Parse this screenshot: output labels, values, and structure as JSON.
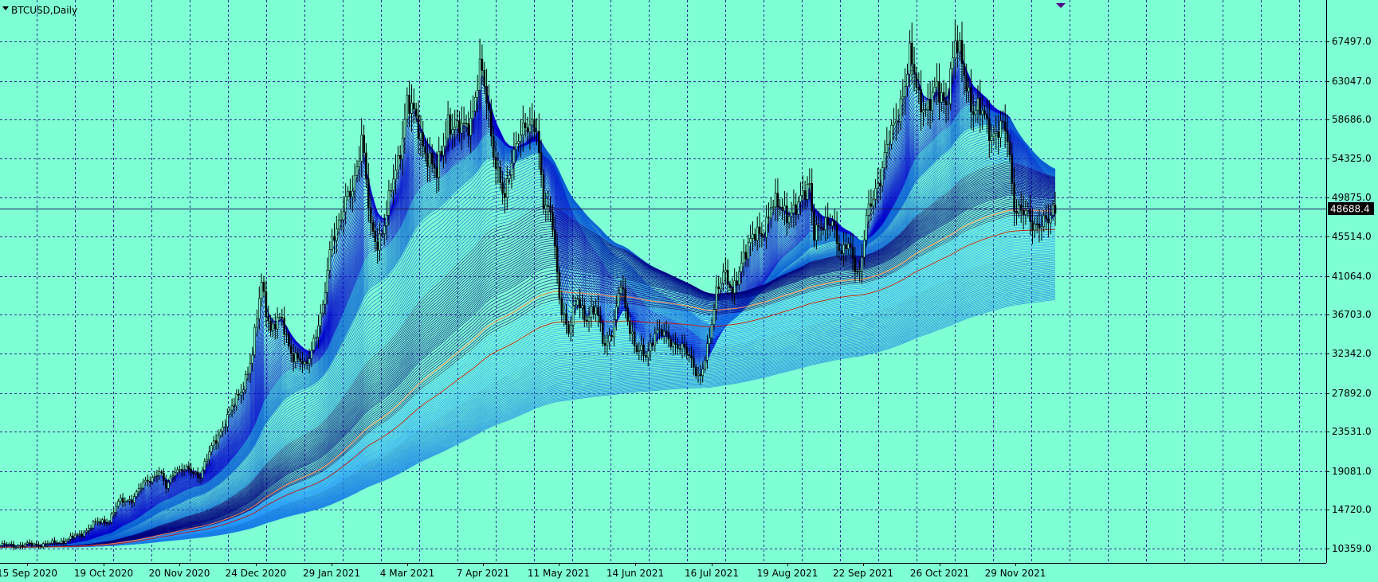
{
  "chart_data": {
    "type": "candlestick",
    "symbol_label": "BTCUSD,Daily",
    "current_price": "48688.4",
    "y_ticks": [
      "67497.0",
      "63047.0",
      "58686.0",
      "54325.0",
      "49875.0",
      "45514.0",
      "41064.0",
      "36703.0",
      "32342.0",
      "27892.0",
      "23531.0",
      "19081.0",
      "14720.0",
      "10359.0"
    ],
    "x_ticks": [
      "15 Sep 2020",
      "19 Oct 2020",
      "20 Nov 2020",
      "24 Dec 2020",
      "29 Jan 2021",
      "4 Mar 2021",
      "7 Apr 2021",
      "11 May 2021",
      "14 Jun 2021",
      "16 Jul 2021",
      "19 Aug 2021",
      "22 Sep 2021",
      "26 Oct 2021",
      "29 Nov 2021"
    ],
    "ylim": [
      8400,
      69500
    ],
    "price_series": [
      [
        "2020-09-15",
        10700
      ],
      [
        "2020-09-25",
        10750
      ],
      [
        "2020-10-08",
        10900
      ],
      [
        "2020-10-15",
        11400
      ],
      [
        "2020-10-20",
        11900
      ],
      [
        "2020-10-26",
        13100
      ],
      [
        "2020-11-02",
        13600
      ],
      [
        "2020-11-06",
        15500
      ],
      [
        "2020-11-12",
        16000
      ],
      [
        "2020-11-18",
        17800
      ],
      [
        "2020-11-24",
        19100
      ],
      [
        "2020-11-27",
        17100
      ],
      [
        "2020-12-01",
        19400
      ],
      [
        "2020-12-08",
        19000
      ],
      [
        "2020-12-12",
        18700
      ],
      [
        "2020-12-16",
        21000
      ],
      [
        "2020-12-21",
        23800
      ],
      [
        "2020-12-27",
        26500
      ],
      [
        "2020-12-31",
        29000
      ],
      [
        "2021-01-04",
        32000
      ],
      [
        "2021-01-08",
        40500
      ],
      [
        "2021-01-12",
        35000
      ],
      [
        "2021-01-17",
        36000
      ],
      [
        "2021-01-22",
        32000
      ],
      [
        "2021-01-27",
        30700
      ],
      [
        "2021-01-31",
        34000
      ],
      [
        "2021-02-04",
        37000
      ],
      [
        "2021-02-08",
        46000
      ],
      [
        "2021-02-12",
        47500
      ],
      [
        "2021-02-17",
        51000
      ],
      [
        "2021-02-21",
        57000
      ],
      [
        "2021-02-25",
        46000
      ],
      [
        "2021-02-28",
        45000
      ],
      [
        "2021-03-04",
        48000
      ],
      [
        "2021-03-09",
        54000
      ],
      [
        "2021-03-13",
        61000
      ],
      [
        "2021-03-17",
        58000
      ],
      [
        "2021-03-22",
        55000
      ],
      [
        "2021-03-26",
        52000
      ],
      [
        "2021-03-31",
        59000
      ],
      [
        "2021-04-04",
        57000
      ],
      [
        "2021-04-08",
        58000
      ],
      [
        "2021-04-11",
        60000
      ],
      [
        "2021-04-14",
        64000
      ],
      [
        "2021-04-17",
        61000
      ],
      [
        "2021-04-21",
        54000
      ],
      [
        "2021-04-25",
        49000
      ],
      [
        "2021-04-28",
        54500
      ],
      [
        "2021-05-01",
        57500
      ],
      [
        "2021-05-05",
        57000
      ],
      [
        "2021-05-09",
        58500
      ],
      [
        "2021-05-12",
        49500
      ],
      [
        "2021-05-16",
        46500
      ],
      [
        "2021-05-19",
        39000
      ],
      [
        "2021-05-23",
        34500
      ],
      [
        "2021-05-27",
        38500
      ],
      [
        "2021-05-31",
        36500
      ],
      [
        "2021-06-04",
        37000
      ],
      [
        "2021-06-08",
        33500
      ],
      [
        "2021-06-12",
        35500
      ],
      [
        "2021-06-15",
        40000
      ],
      [
        "2021-06-19",
        35500
      ],
      [
        "2021-06-22",
        32500
      ],
      [
        "2021-06-26",
        32000
      ],
      [
        "2021-06-30",
        35000
      ],
      [
        "2021-07-05",
        34000
      ],
      [
        "2021-07-10",
        33500
      ],
      [
        "2021-07-15",
        31800
      ],
      [
        "2021-07-20",
        29900
      ],
      [
        "2021-07-24",
        33500
      ],
      [
        "2021-07-27",
        39500
      ],
      [
        "2021-07-30",
        42000
      ],
      [
        "2021-08-03",
        38500
      ],
      [
        "2021-08-08",
        44000
      ],
      [
        "2021-08-12",
        45000
      ],
      [
        "2021-08-16",
        46000
      ],
      [
        "2021-08-20",
        49000
      ],
      [
        "2021-08-24",
        48500
      ],
      [
        "2021-08-28",
        48500
      ],
      [
        "2021-09-01",
        48500
      ],
      [
        "2021-09-06",
        52000
      ],
      [
        "2021-09-08",
        46200
      ],
      [
        "2021-09-12",
        46000
      ],
      [
        "2021-09-16",
        48000
      ],
      [
        "2021-09-20",
        43000
      ],
      [
        "2021-09-23",
        44500
      ],
      [
        "2021-09-28",
        41500
      ],
      [
        "2021-10-01",
        47000
      ],
      [
        "2021-10-05",
        51000
      ],
      [
        "2021-10-09",
        54500
      ],
      [
        "2021-10-13",
        57500
      ],
      [
        "2021-10-16",
        61000
      ],
      [
        "2021-10-20",
        65500
      ],
      [
        "2021-10-24",
        61000
      ],
      [
        "2021-10-28",
        60500
      ],
      [
        "2021-11-01",
        61500
      ],
      [
        "2021-11-05",
        61000
      ],
      [
        "2021-11-09",
        67000
      ],
      [
        "2021-11-13",
        64000
      ],
      [
        "2021-11-17",
        60000
      ],
      [
        "2021-11-21",
        59000
      ],
      [
        "2021-11-25",
        57500
      ],
      [
        "2021-11-29",
        57500
      ],
      [
        "2021-12-02",
        56500
      ],
      [
        "2021-12-05",
        49500
      ],
      [
        "2021-12-09",
        48000
      ],
      [
        "2021-12-13",
        46800
      ],
      [
        "2021-12-16",
        47500
      ],
      [
        "2021-12-20",
        46800
      ],
      [
        "2021-12-23",
        48600
      ]
    ],
    "series": [
      {
        "values": []
      },
      {
        "values": []
      }
    ],
    "colors": {
      "background": "#7fffd4",
      "grid": "#2a2a8c",
      "candle": "#000000",
      "ma_dark": "#000080",
      "ma_mid": "#0000cd",
      "ma_light": "#1e90ff",
      "ma_orange": "#ff7f50",
      "ma_red": "#b22222",
      "price_line": "#1a1a66",
      "tag_bg": "#000000",
      "marker": "#4b0082"
    },
    "grid": true
  }
}
